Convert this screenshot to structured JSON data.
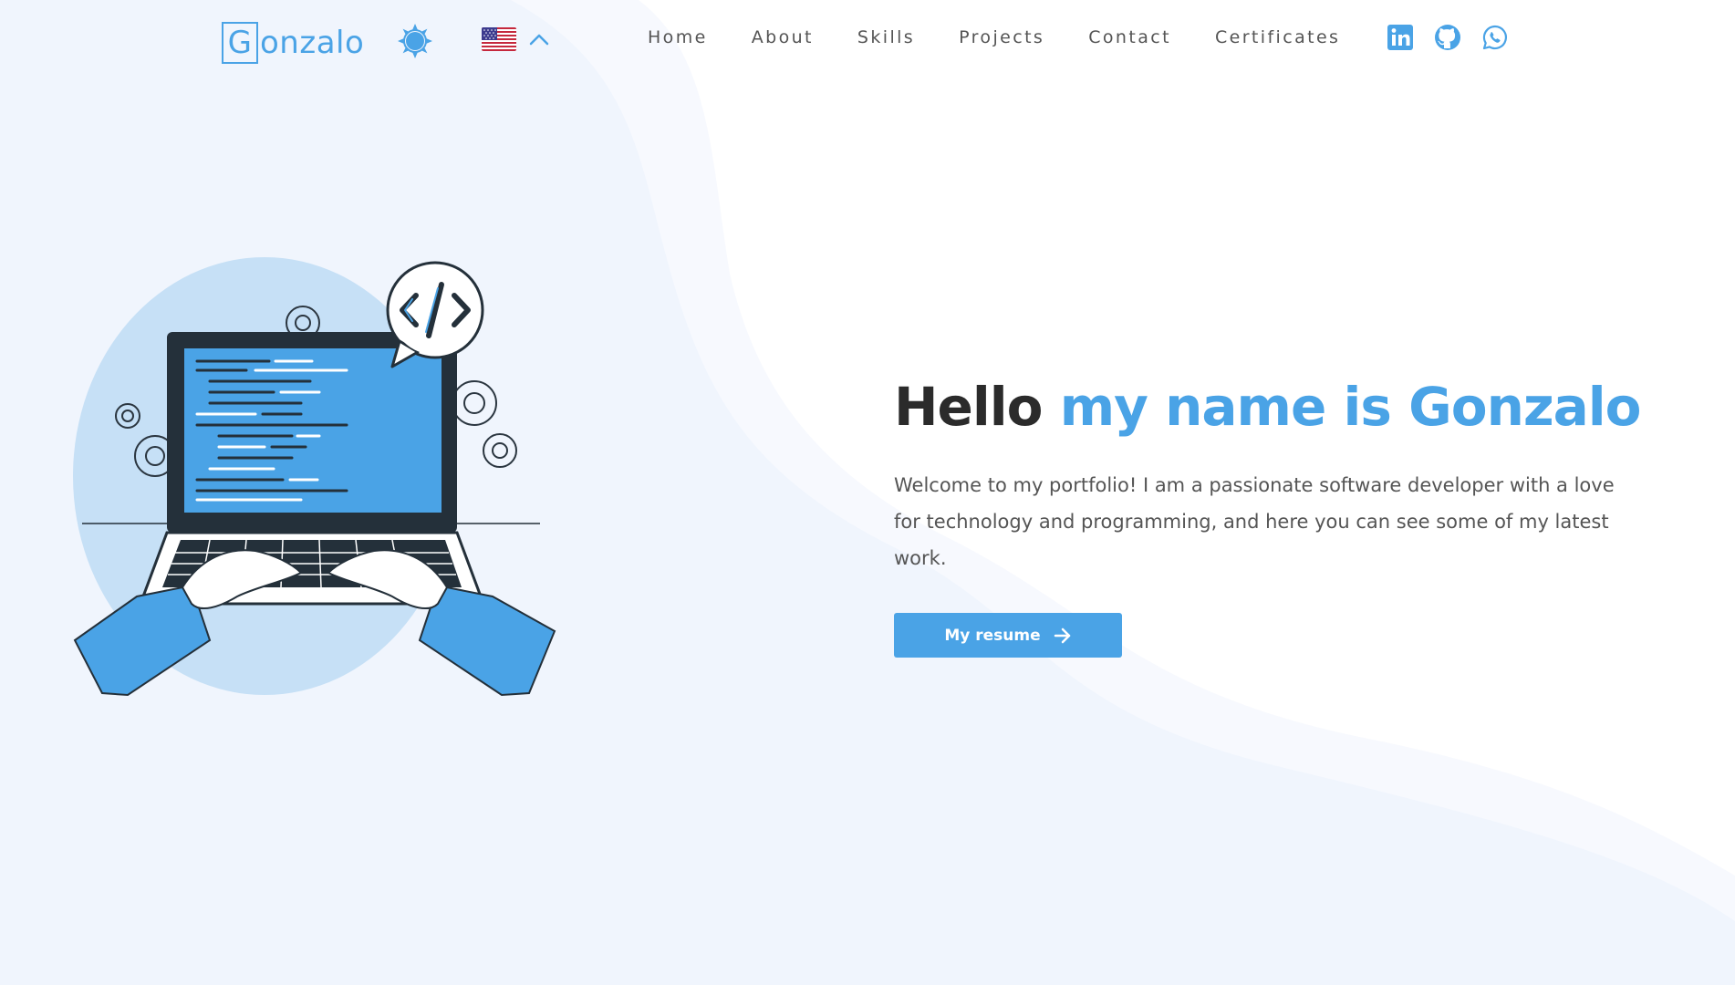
{
  "brand": {
    "logo_initial": "G",
    "logo_rest": "onzalo"
  },
  "colors": {
    "accent": "#4aa3e6",
    "background": "#f0f5fd",
    "text_dark": "#2b2b2b",
    "text_muted": "#555555"
  },
  "header": {
    "theme_toggle_icon": "sun-icon",
    "language": {
      "flag": "us-flag-icon",
      "caret": "chevron-up-icon"
    },
    "nav": [
      {
        "label": "Home"
      },
      {
        "label": "About"
      },
      {
        "label": "Skills"
      },
      {
        "label": "Projects"
      },
      {
        "label": "Contact"
      },
      {
        "label": "Certificates"
      }
    ],
    "socials": [
      {
        "icon": "linkedin-icon"
      },
      {
        "icon": "github-icon"
      },
      {
        "icon": "whatsapp-icon"
      }
    ]
  },
  "hero": {
    "title_plain": "Hello ",
    "title_accent": "my name is Gonzalo",
    "description": "Welcome to my portfolio! I am a passionate software developer with a love for technology and programming, and here you can see some of my latest work.",
    "cta_label": "My resume",
    "cta_icon": "arrow-right-icon",
    "illustration": "developer-laptop-illustration"
  }
}
